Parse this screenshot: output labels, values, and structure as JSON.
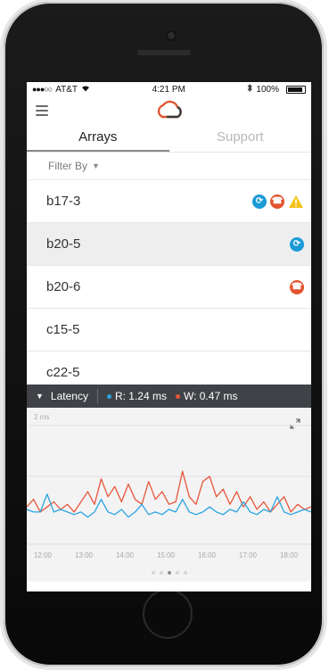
{
  "status_bar": {
    "carrier": "AT&T",
    "time": "4:21 PM",
    "battery": "100%"
  },
  "tabs": [
    {
      "label": "Arrays",
      "active": true
    },
    {
      "label": "Support",
      "active": false
    }
  ],
  "filter": {
    "label": "Filter By"
  },
  "arrays": [
    {
      "name": "b17-3",
      "badges": [
        "sync-blue",
        "support-red",
        "warning-yellow"
      ]
    },
    {
      "name": "b20-5",
      "badges": [
        "sync-blue"
      ],
      "selected": true
    },
    {
      "name": "b20-6",
      "badges": [
        "support-red"
      ]
    },
    {
      "name": "c15-5",
      "badges": []
    },
    {
      "name": "c22-5",
      "badges": []
    }
  ],
  "latency": {
    "label": "Latency",
    "read": "R: 1.24 ms",
    "write": "W: 0.47 ms",
    "read_color": "#2aa4e0",
    "write_color": "#e8553a"
  },
  "colors": {
    "accent_blue": "#1a9ad6",
    "accent_red": "#e2532d",
    "warning": "#f4c21c"
  },
  "chart_data": {
    "type": "line",
    "ylabel": "2 ms",
    "x_ticks": [
      "12:00",
      "13:00",
      "14:00",
      "15:00",
      "16:00",
      "17:00",
      "18:00"
    ],
    "xlim": [
      12,
      18.3
    ],
    "ylim": [
      0,
      2
    ],
    "series": [
      {
        "color": "#e8553a",
        "x": [
          12,
          12.15,
          12.3,
          12.45,
          12.6,
          12.75,
          12.9,
          13.05,
          13.2,
          13.35,
          13.5,
          13.65,
          13.8,
          13.95,
          14.1,
          14.25,
          14.4,
          14.55,
          14.7,
          14.85,
          15,
          15.15,
          15.3,
          15.45,
          15.6,
          15.75,
          15.9,
          16.05,
          16.2,
          16.35,
          16.5,
          16.65,
          16.8,
          16.95,
          17.1,
          17.25,
          17.4,
          17.55,
          17.7,
          17.85,
          18,
          18.15,
          18.3
        ],
        "y": [
          0.4,
          0.55,
          0.3,
          0.4,
          0.5,
          0.35,
          0.45,
          0.3,
          0.5,
          0.7,
          0.45,
          0.95,
          0.6,
          0.8,
          0.5,
          0.85,
          0.55,
          0.45,
          0.9,
          0.55,
          0.7,
          0.45,
          0.5,
          1.1,
          0.6,
          0.45,
          0.9,
          1.0,
          0.6,
          0.75,
          0.45,
          0.7,
          0.4,
          0.6,
          0.35,
          0.5,
          0.3,
          0.45,
          0.6,
          0.3,
          0.45,
          0.35,
          0.4
        ]
      },
      {
        "color": "#2aa4e0",
        "x": [
          12,
          12.15,
          12.3,
          12.45,
          12.6,
          12.75,
          12.9,
          13.05,
          13.2,
          13.35,
          13.5,
          13.65,
          13.8,
          13.95,
          14.1,
          14.25,
          14.4,
          14.55,
          14.7,
          14.85,
          15,
          15.15,
          15.3,
          15.45,
          15.6,
          15.75,
          15.9,
          16.05,
          16.2,
          16.35,
          16.5,
          16.65,
          16.8,
          16.95,
          17.1,
          17.25,
          17.4,
          17.55,
          17.7,
          17.85,
          18,
          18.15,
          18.3
        ],
        "y": [
          0.35,
          0.3,
          0.3,
          0.65,
          0.3,
          0.35,
          0.3,
          0.25,
          0.3,
          0.2,
          0.3,
          0.55,
          0.3,
          0.25,
          0.35,
          0.2,
          0.3,
          0.45,
          0.25,
          0.3,
          0.25,
          0.35,
          0.3,
          0.55,
          0.3,
          0.25,
          0.3,
          0.4,
          0.3,
          0.25,
          0.35,
          0.3,
          0.5,
          0.3,
          0.25,
          0.35,
          0.3,
          0.6,
          0.3,
          0.25,
          0.3,
          0.35,
          0.3
        ]
      }
    ]
  },
  "pager": {
    "count": 5,
    "active": 2
  }
}
